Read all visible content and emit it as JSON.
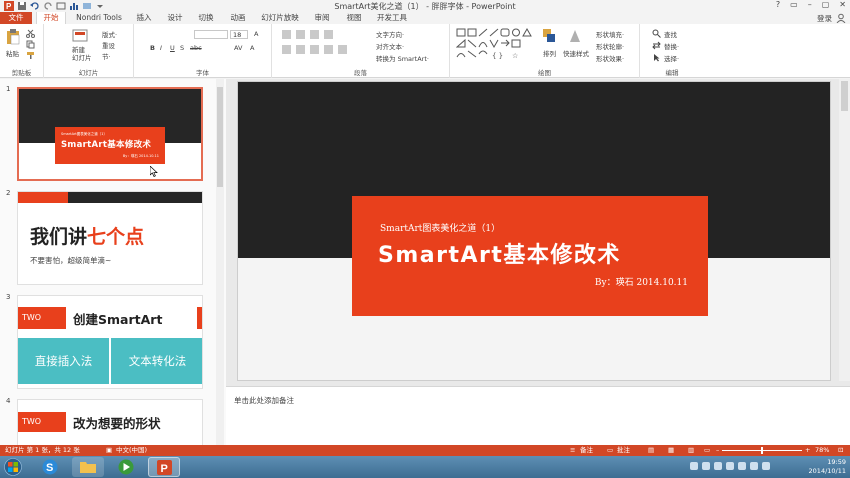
{
  "titlebar": {
    "title": "SmartArt美化之道（1） - 胖胖字体 - PowerPoint",
    "help": "?",
    "controls": [
      "▭",
      "–",
      "▢",
      "✕"
    ]
  },
  "tabs": [
    {
      "label": "文件",
      "key": "file"
    },
    {
      "label": "开始",
      "key": "home"
    },
    {
      "label": "Nondri Tools",
      "key": "nondri"
    },
    {
      "label": "插入",
      "key": "insert"
    },
    {
      "label": "设计",
      "key": "design"
    },
    {
      "label": "切换",
      "key": "transitions"
    },
    {
      "label": "动画",
      "key": "animations"
    },
    {
      "label": "幻灯片放映",
      "key": "slideshow"
    },
    {
      "label": "审阅",
      "key": "review"
    },
    {
      "label": "视图",
      "key": "view"
    },
    {
      "label": "开发工具",
      "key": "developer"
    }
  ],
  "signin": "登录",
  "ribbon": {
    "paste": "粘贴",
    "new_slide": "新建\n幻灯片",
    "layout": "版式·",
    "reset": "重设",
    "section": "节·",
    "font_size": "18",
    "text_direction": "文字方向·",
    "align_text": "对齐文本·",
    "convert_smartart": "转换为 SmartArt·",
    "arrange": "排列",
    "quick_styles": "快速样式",
    "shape_fill": "形状填充·",
    "shape_outline": "形状轮廓·",
    "shape_effects": "形状效果·",
    "find": "查找",
    "replace": "替换·",
    "select": "选择·",
    "groups": {
      "clipboard": "剪贴板",
      "slides": "幻灯片",
      "font": "字体",
      "paragraph": "段落",
      "drawing": "绘图",
      "editing": "编辑"
    }
  },
  "thumbnails": {
    "numbers": [
      "1",
      "2",
      "3",
      "4"
    ],
    "slide1": {
      "subtitle": "SmartArt图表美化之道（1）",
      "title": "SmartArt基本修改术",
      "byline": "By：瑛石   2014.10.11"
    },
    "slide2": {
      "head_black": "我们讲",
      "head_red": "七个点",
      "sub": "不要害怕，超级简单滴~"
    },
    "slide3": {
      "badge": "TWO",
      "head": "创建SmartArt",
      "left": "直接插入法",
      "right": "文本转化法"
    },
    "slide4": {
      "badge": "TWO",
      "head": "改为想要的形状"
    }
  },
  "slide": {
    "subtitle": "SmartArt图表美化之道（1）",
    "title": "SmartArt基本修改术",
    "byline": "By：瑛石   2014.10.11"
  },
  "notes_placeholder": "单击此处添加备注",
  "statusbar": {
    "slide_info": "幻灯片 第 1 张，共 12 张",
    "language": "中文(中国)",
    "notes": "备注",
    "comments": "批注",
    "zoom": "78%",
    "zoom_level": 0.5
  },
  "taskbar": {
    "time": "19:59",
    "date": "2014/10/11"
  },
  "colors": {
    "accent": "#d24726",
    "slide_red": "#e8401c",
    "slide_dark": "#232323",
    "teal": "#4bbec3"
  }
}
